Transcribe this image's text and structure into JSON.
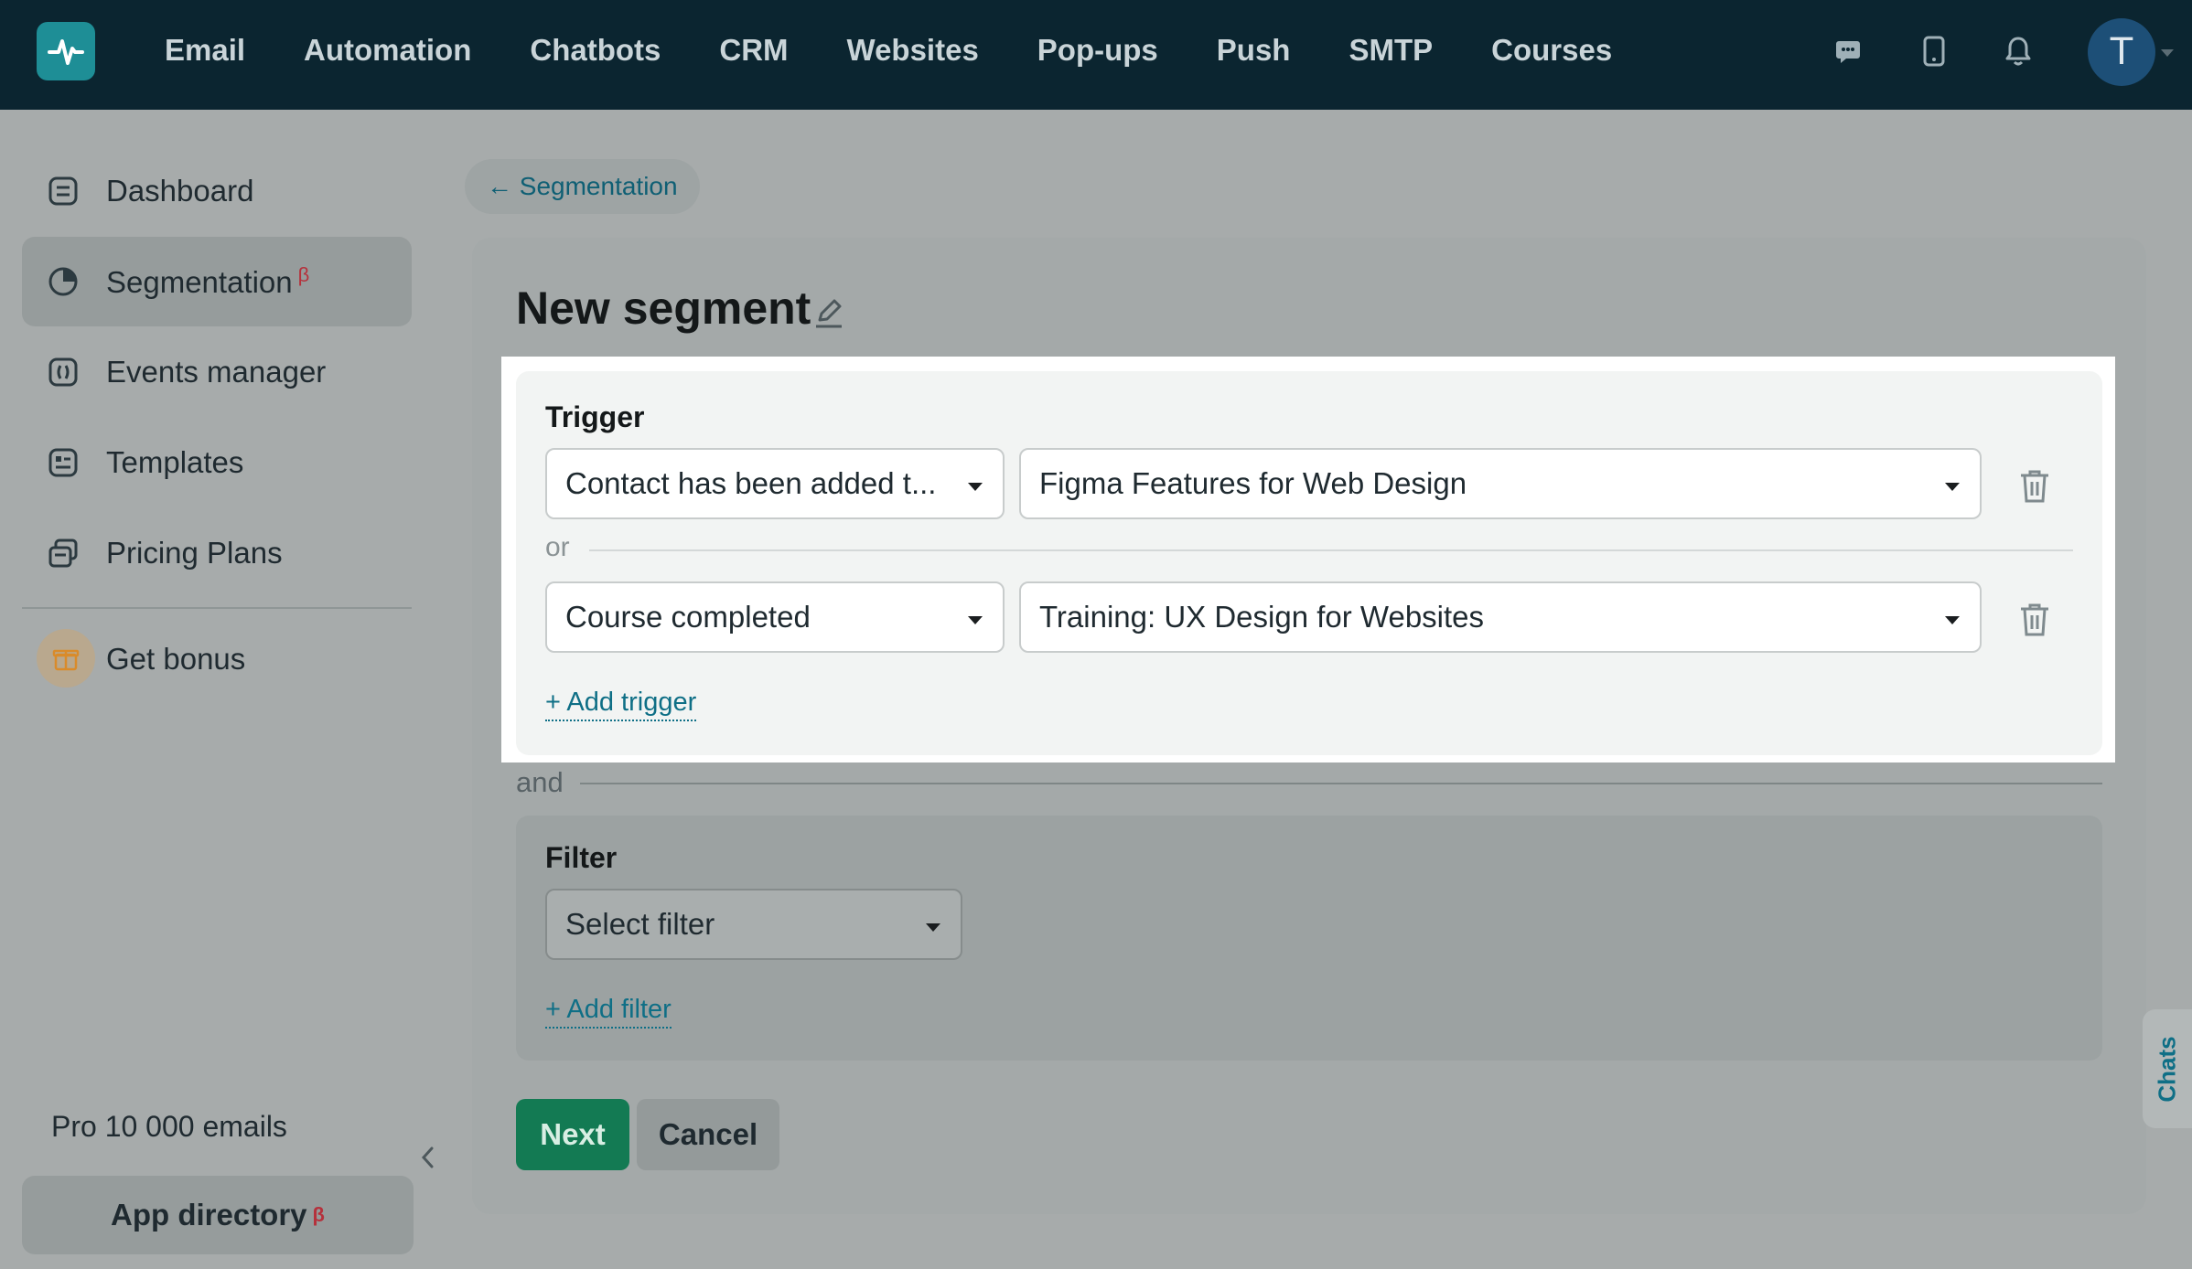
{
  "topnav": {
    "items": [
      "Email",
      "Automation",
      "Chatbots",
      "CRM",
      "Websites",
      "Pop-ups",
      "Push",
      "SMTP",
      "Courses"
    ],
    "avatar_initial": "T"
  },
  "sidebar": {
    "items": [
      {
        "label": "Dashboard",
        "icon": "dashboard-icon"
      },
      {
        "label": "Segmentation",
        "icon": "segmentation-icon",
        "badge": "β",
        "active": true
      },
      {
        "label": "Events manager",
        "icon": "events-icon"
      },
      {
        "label": "Templates",
        "icon": "templates-icon"
      },
      {
        "label": "Pricing Plans",
        "icon": "pricing-icon"
      }
    ],
    "bonus_label": "Get bonus",
    "plan_text": "Pro 10 000 emails",
    "app_directory_label": "App directory",
    "app_directory_badge": "β"
  },
  "main": {
    "breadcrumb": "← Segmentation",
    "title": "New segment",
    "trigger": {
      "label": "Trigger",
      "rows": [
        {
          "condition": "Contact has been added t...",
          "value": "Figma Features for Web Design"
        },
        {
          "condition": "Course completed",
          "value": "Training: UX Design for Websites"
        }
      ],
      "or_label": "or",
      "add_label": "+ Add trigger"
    },
    "and_label": "and",
    "filter": {
      "label": "Filter",
      "placeholder": "Select filter",
      "add_label": "+ Add filter"
    },
    "buttons": {
      "next": "Next",
      "cancel": "Cancel"
    }
  },
  "chats_tab": "Chats",
  "colors": {
    "topbar": "#0b2530",
    "accent_teal": "#1e8e96",
    "link": "#0f6f86",
    "primary_button": "#137a53",
    "beta_badge": "#b5313c"
  }
}
